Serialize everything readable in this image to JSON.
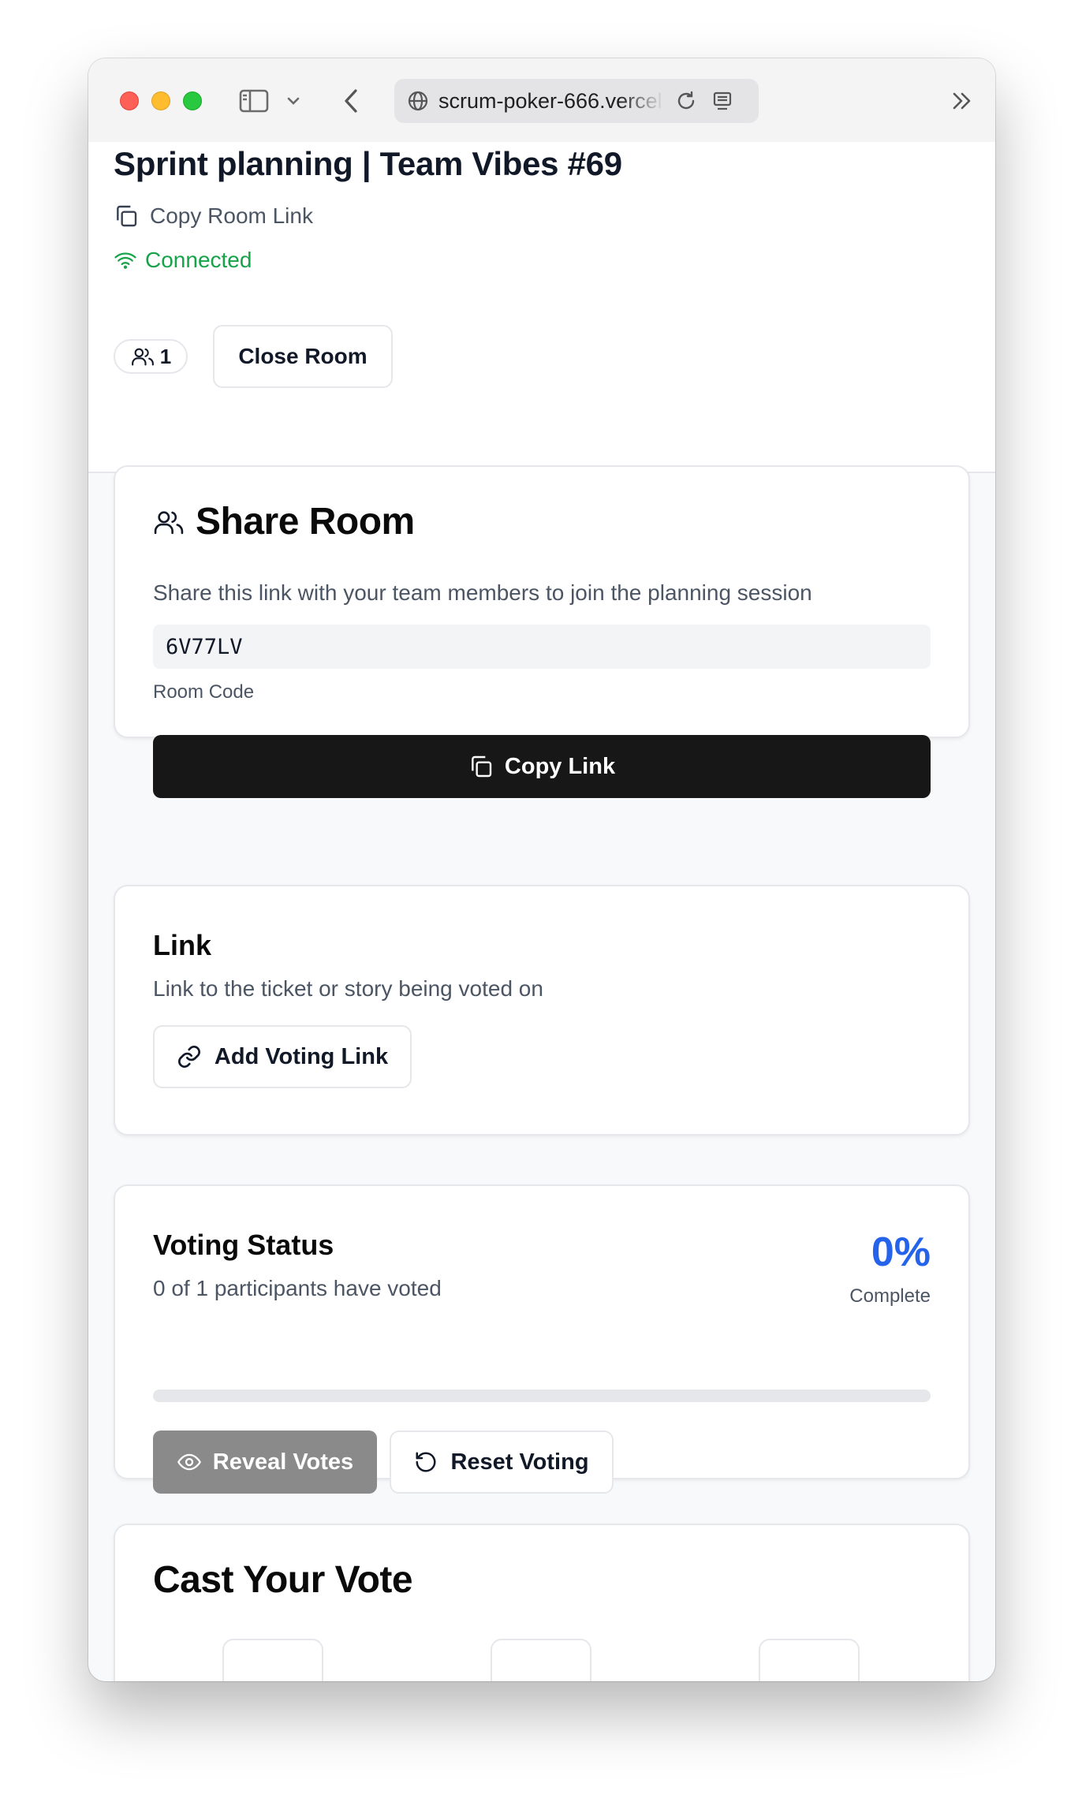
{
  "browser": {
    "url": "scrum-poker-666.vercel.app"
  },
  "room": {
    "title": "Sprint planning | Team Vibes #69",
    "copy_room_link_label": "Copy Room Link",
    "connection_status": "Connected",
    "participants_count": "1",
    "close_room_label": "Close Room"
  },
  "share_card": {
    "title": "Share Room",
    "description": "Share this link with your team members to join the planning session",
    "room_code": "6V77LV",
    "room_code_label": "Room Code",
    "copy_link_label": "Copy Link"
  },
  "link_card": {
    "title": "Link",
    "description": "Link to the ticket or story being voted on",
    "add_link_label": "Add Voting Link"
  },
  "voting_status": {
    "title": "Voting Status",
    "summary": "0 of 1 participants have voted",
    "percent_text": "0%",
    "percent_value": 0,
    "complete_label": "Complete",
    "reveal_label": "Reveal Votes",
    "reset_label": "Reset Voting"
  },
  "cast_vote": {
    "title": "Cast Your Vote"
  },
  "colors": {
    "accent_blue": "#2563eb",
    "connected_green": "#16a34a",
    "primary_button": "#171717",
    "disabled_button": "#8a8a8a"
  },
  "icons": [
    "sidebar-icon",
    "chevron-down-icon",
    "back-icon",
    "globe-icon",
    "reload-icon",
    "reader-icon",
    "more-tools-icon",
    "copy-icon",
    "wifi-icon",
    "users-icon",
    "link-icon",
    "eye-icon",
    "rotate-ccw-icon"
  ]
}
